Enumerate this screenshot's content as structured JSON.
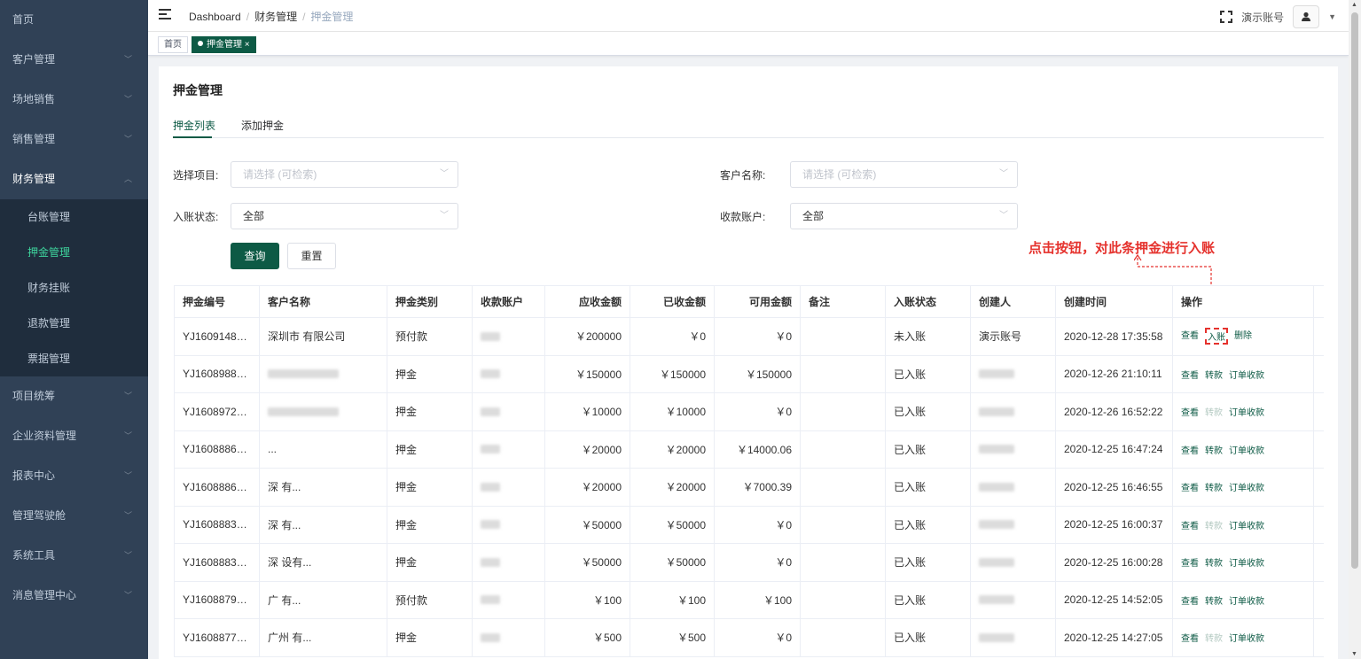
{
  "sidebar": {
    "items": [
      {
        "label": "首页",
        "arrow": ""
      },
      {
        "label": "客户管理",
        "arrow": "﹀"
      },
      {
        "label": "场地销售",
        "arrow": "﹀"
      },
      {
        "label": "销售管理",
        "arrow": "﹀"
      },
      {
        "label": "财务管理",
        "arrow": "︿"
      },
      {
        "label": "项目统筹",
        "arrow": "﹀"
      },
      {
        "label": "企业资料管理",
        "arrow": "﹀"
      },
      {
        "label": "报表中心",
        "arrow": "﹀"
      },
      {
        "label": "管理驾驶舱",
        "arrow": "﹀"
      },
      {
        "label": "系统工具",
        "arrow": "﹀"
      },
      {
        "label": "消息管理中心",
        "arrow": "﹀"
      }
    ],
    "finance_sub": [
      "台账管理",
      "押金管理",
      "财务挂账",
      "退款管理",
      "票据管理"
    ]
  },
  "header": {
    "breadcrumb": [
      "Dashboard",
      "财务管理",
      "押金管理"
    ],
    "breadcrumb_sep": "/",
    "account": "演示账号"
  },
  "tags": {
    "home": "首页",
    "active": "押金管理",
    "close": "×"
  },
  "page": {
    "title": "押金管理",
    "tabs": [
      "押金列表",
      "添加押金"
    ]
  },
  "filters": {
    "project_label": "选择项目:",
    "project_placeholder": "请选择 (可检索)",
    "customer_label": "客户名称:",
    "customer_placeholder": "请选择 (可检索)",
    "status_label": "入账状态:",
    "status_value": "全部",
    "account_label": "收款账户:",
    "account_value": "全部",
    "query": "查询",
    "reset": "重置"
  },
  "annotation": "点击按钮，对此条押金进行入账",
  "table": {
    "columns": [
      "押金编号",
      "客户名称",
      "押金类别",
      "收款账户",
      "应收金额",
      "已收金额",
      "可用金额",
      "备注",
      "入账状态",
      "创建人",
      "创建时间",
      "操作"
    ],
    "rows": [
      {
        "id": "YJ16091481...",
        "customer": "深圳市        有限公司",
        "type": "预付款",
        "receivable": "￥200000",
        "received": "￥0",
        "available": "￥0",
        "status": "未入账",
        "creator": "演示账号",
        "time": "2020-12-28 17:35:58",
        "ops": [
          "查看",
          "入账",
          "删除"
        ]
      },
      {
        "id": "YJ16089882...",
        "customer": "",
        "type": "押金",
        "receivable": "￥150000",
        "received": "￥150000",
        "available": "￥150000",
        "status": "已入账",
        "creator": "",
        "time": "2020-12-26 21:10:11",
        "ops": [
          "查看",
          "转款",
          "订单收款"
        ]
      },
      {
        "id": "YJ16089727...",
        "customer": "",
        "type": "押金",
        "receivable": "￥10000",
        "received": "￥10000",
        "available": "￥0",
        "status": "已入账",
        "creator": "",
        "time": "2020-12-26 16:52:22",
        "ops": [
          "查看",
          "转款",
          "订单收款"
        ]
      },
      {
        "id": "YJ16088860...",
        "customer": "...",
        "type": "押金",
        "receivable": "￥20000",
        "received": "￥20000",
        "available": "￥14000.06",
        "status": "已入账",
        "creator": "",
        "time": "2020-12-25 16:47:24",
        "ops": [
          "查看",
          "转款",
          "订单收款"
        ]
      },
      {
        "id": "YJ16088860...",
        "customer": "深        有...",
        "type": "押金",
        "receivable": "￥20000",
        "received": "￥20000",
        "available": "￥7000.39",
        "status": "已入账",
        "creator": "",
        "time": "2020-12-25 16:46:55",
        "ops": [
          "查看",
          "转款",
          "订单收款"
        ]
      },
      {
        "id": "YJ16088832...",
        "customer": "深        有...",
        "type": "押金",
        "receivable": "￥50000",
        "received": "￥50000",
        "available": "￥0",
        "status": "已入账",
        "creator": "",
        "time": "2020-12-25 16:00:37",
        "ops": [
          "查看",
          "转款",
          "订单收款"
        ]
      },
      {
        "id": "YJ16088832...",
        "customer": "深        设有...",
        "type": "押金",
        "receivable": "￥50000",
        "received": "￥50000",
        "available": "￥0",
        "status": "已入账",
        "creator": "",
        "time": "2020-12-25 16:00:28",
        "ops": [
          "查看",
          "转款",
          "订单收款"
        ]
      },
      {
        "id": "YJ16088791...",
        "customer": "广        有...",
        "type": "预付款",
        "receivable": "￥100",
        "received": "￥100",
        "available": "￥100",
        "status": "已入账",
        "creator": "",
        "time": "2020-12-25 14:52:05",
        "ops": [
          "查看",
          "转款",
          "订单收款"
        ]
      },
      {
        "id": "YJ16088776...",
        "customer": "广州        有...",
        "type": "押金",
        "receivable": "￥500",
        "received": "￥500",
        "available": "￥0",
        "status": "已入账",
        "creator": "",
        "time": "2020-12-25 14:27:05",
        "ops": [
          "查看",
          "转款",
          "订单收款"
        ]
      }
    ]
  },
  "colors": {
    "primary": "#0d5a45",
    "sidebar": "#304156",
    "annotation": "#e5322d"
  }
}
